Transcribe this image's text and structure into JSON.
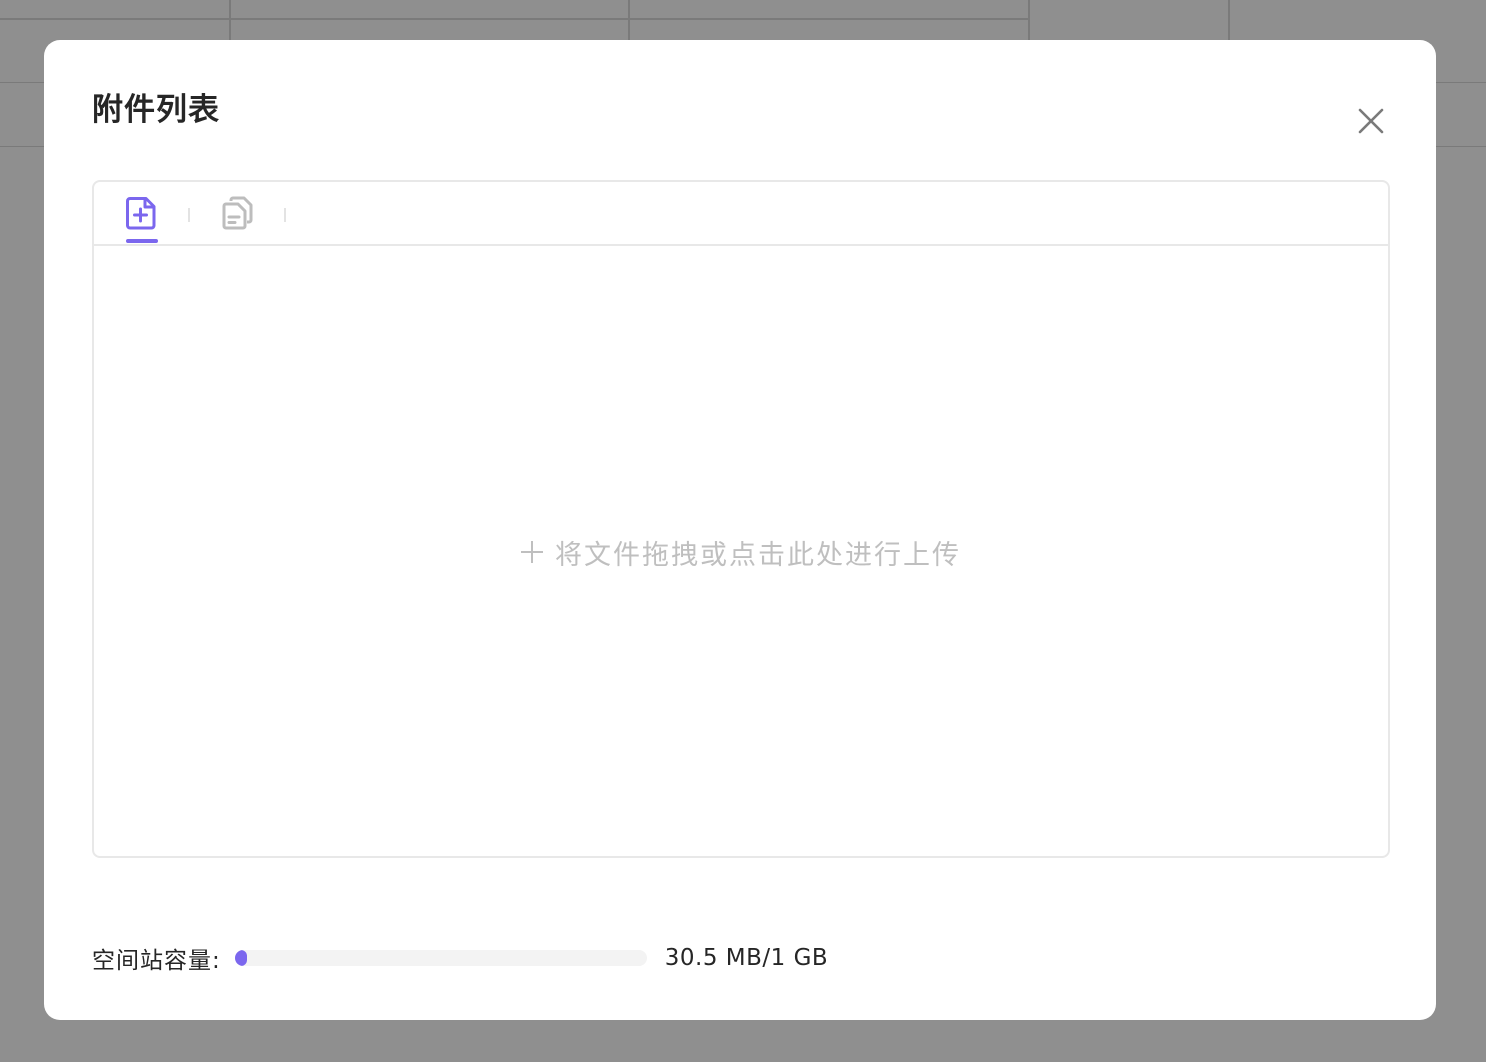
{
  "dialog": {
    "title": "附件列表",
    "close_icon": "close-icon"
  },
  "tabs": [
    {
      "icon": "file-add-icon",
      "active": true
    },
    {
      "icon": "files-copy-icon",
      "active": false
    }
  ],
  "dropzone": {
    "text": "将文件拖拽或点击此处进行上传",
    "icon": "plus-icon"
  },
  "storage": {
    "label": "空间站容量:",
    "value": "30.5 MB/1 GB",
    "used_fraction": 0.0298
  },
  "colors": {
    "accent": "#7b67ee",
    "placeholder_text": "#bfbfbf",
    "title_text": "#262626"
  }
}
